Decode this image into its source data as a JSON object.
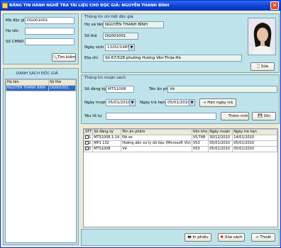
{
  "window": {
    "title": "ĐĂNG TIN HÀNH NGHỀ TRA TÀI LIỆU CHO ĐỘC GIẢ: NGUYỄN THANH BÌNH"
  },
  "left": {
    "ma_doc_gia_label": "Mã độc giả",
    "ma_doc_gia_value": "DG001001",
    "ho_ten_label": "Họ tên",
    "ho_ten_value": "",
    "so_cmnd_label": "Số CMND",
    "so_cmnd_value": "",
    "search_label": "Tìm kiếm",
    "list_title": "DANH SÁCH ĐỘC GIẢ",
    "columns": [
      "Họ tên",
      "Số thẻ"
    ],
    "rows": [
      [
        "NGUYỄN THANH BÌNH",
        "DG001001"
      ]
    ]
  },
  "info": {
    "group_title": "Thông tin chi tiết độc giả",
    "ho_ten_label": "Họ và tên",
    "ho_ten_value": "NGUYỄN THANH BÌNH",
    "so_the_label": "Số thẻ",
    "so_the_value": "DG001001",
    "ngay_sinh_label": "Ngày sinh",
    "ngay_sinh_value": "13/02/1985",
    "dia_chi_label": "Địa chỉ",
    "dia_chi_value": "Số 67/528 phường Hương Vân-Thừa-Hà",
    "photo_button": "Sửa"
  },
  "loan": {
    "group_title": "Thông tin mượn sách",
    "so_dang_ky_label": "Số đăng ký",
    "so_dang_ky_value": "MTS1008",
    "ten_an_pham_label": "Tên ấn phẩm",
    "ten_an_pham_value": "Vẽ",
    "ngay_muon_label": "Ngày mượn",
    "ngay_muon_value": "05/01/2010",
    "ngay_tra_label": "Ngày trả hẹn",
    "ngay_tra_value": "05/01/2010",
    "hen_ngay_tra_button": "Hẹn ngày trả",
    "ghi_chu_label": "Yêu tố tự",
    "ghi_chu_value": "",
    "them_moi_button": "Thêm mới",
    "ghi_button": "Ghi"
  },
  "table": {
    "columns": [
      "STT",
      "Số đăng ký",
      "Tên ấn phẩm",
      "Vốn kho",
      "Ngày mượn",
      "Ngày trả hẹn"
    ],
    "rows": [
      [
        "1",
        "MTS1008.1.14",
        "Đề xe",
        "VS-T48",
        "30/12/2010",
        "14/01/2010"
      ],
      [
        "2",
        "MP1 132",
        "Hướng dẫn xử lý dữ liệu (Microsoft Vis)",
        "VS3",
        "05/01/2010",
        "05/01/2010"
      ],
      [
        "3",
        "MTS1008",
        "Vẽ",
        "VS3",
        "05/01/2010",
        "05/01/2010"
      ]
    ]
  },
  "footer": {
    "in_button": "In phiếu",
    "xoa_button": "Xóa sách",
    "thoat_button": "Thoát"
  }
}
